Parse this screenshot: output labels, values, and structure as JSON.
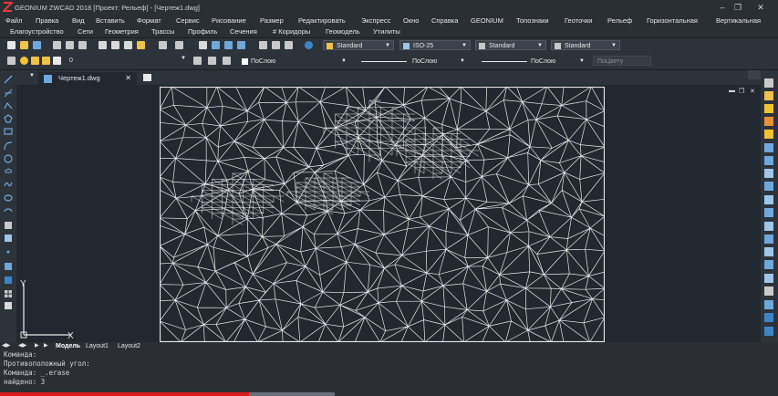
{
  "window": {
    "title": "GEONIUM ZWCAD 2018 [Проект: Рельеф] - [Чертеж1.dwg]",
    "controls": [
      "–",
      "❐",
      "✕"
    ]
  },
  "menu_row1": [
    "Файл",
    "Правка",
    "Вид",
    "Вставить",
    "Формат",
    "Сервис",
    "Рисование",
    "Размер",
    "Редактировать",
    "Экспресс",
    "Окно",
    "Справка",
    "GEONIUM",
    "Топознаки",
    "Геоточки",
    "Рельеф",
    "Горизонтальная",
    "Вертикальная"
  ],
  "menu_row2": [
    "Благоустройство",
    "Сети",
    "Геометрия",
    "Трассы",
    "Профиль",
    "Сечения",
    "# Коридоры",
    "Геомодель",
    "Утилиты"
  ],
  "toolbar": {
    "text_style": "Standard",
    "dim_style": "ISO-25",
    "table_style": "Standard",
    "multileader_style": "Standard",
    "layer": "0",
    "color": "ПоСлою",
    "linetype": "ПоСлою",
    "lineweight": "ПоСлою",
    "plotstyle": "ПоЦвету"
  },
  "document_tab": "Чертеж1.dwg",
  "ucs": {
    "x_label": "X",
    "y_label": "Y"
  },
  "layout_tabs": [
    "Модель",
    "Layout1",
    "Layout2"
  ],
  "command_lines": [
    "Команда:",
    "Противоположный угол:",
    "Команда: _.erase",
    "найдено: 3"
  ],
  "progress": 0.32,
  "colors": {
    "background": "#212830",
    "mesh": "#e8e8e8",
    "accent_red": "#e0191d"
  }
}
